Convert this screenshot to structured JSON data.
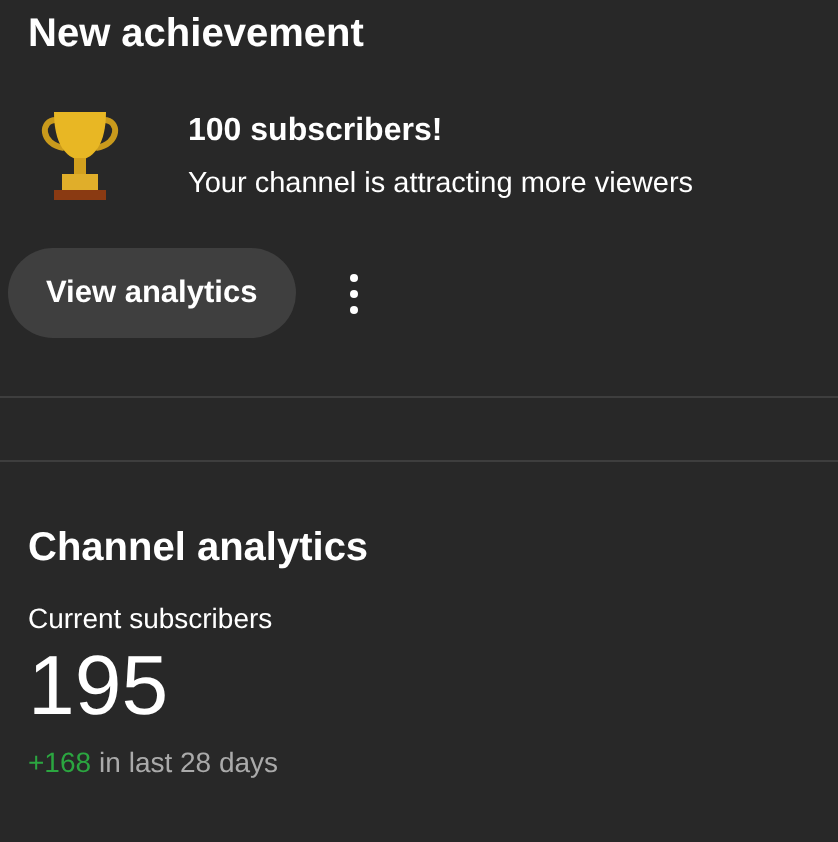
{
  "achievement": {
    "title": "New achievement",
    "headline": "100 subscribers!",
    "description": "Your channel is attracting more viewers",
    "button": "View analytics"
  },
  "analytics": {
    "title": "Channel analytics",
    "metric_label": "Current subscribers",
    "metric_value": "195",
    "change": "+168",
    "change_period": "in last 28 days"
  }
}
